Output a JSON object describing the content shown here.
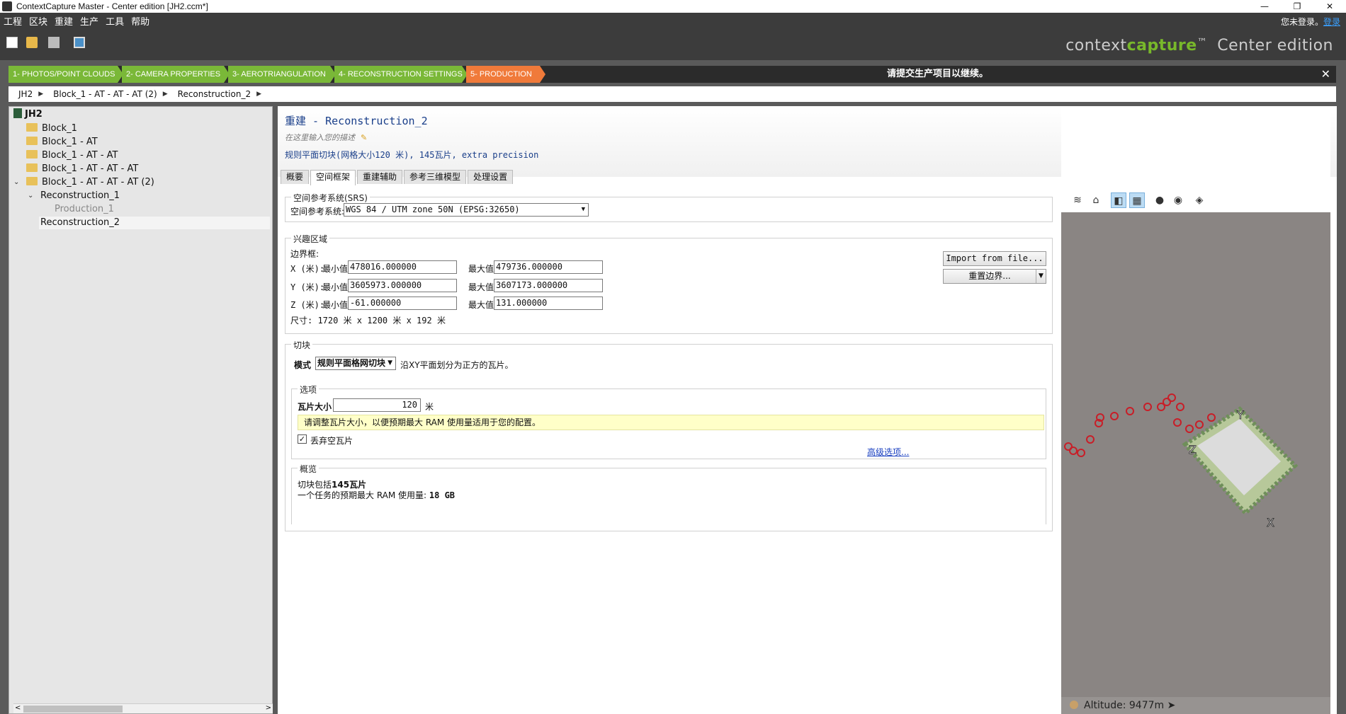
{
  "window": {
    "title": "ContextCapture Master - Center edition [JH2.ccm*]",
    "controls": [
      "—",
      "❐",
      "✕"
    ]
  },
  "menu": {
    "items": [
      "工程",
      "区块",
      "重建",
      "生产",
      "工具",
      "帮助"
    ],
    "login_text": "您未登录。",
    "login_link": "登录"
  },
  "brand": {
    "prefix": "context",
    "accent": "capture",
    "tm": "™",
    "edition": "Center edition",
    "accent_color": "#78b82a"
  },
  "steps": {
    "items": [
      "1- PHOTOS/POINT CLOUDS",
      "2- CAMERA PROPERTIES",
      "3- AEROTRIANGULATION",
      "4- RECONSTRUCTION SETTINGS",
      "5- PRODUCTION"
    ],
    "active_index": 4,
    "notice": "请提交生产项目以继续。",
    "done_color": "#7ab838",
    "active_color": "#f07a3a"
  },
  "breadcrumb": [
    "JH2",
    "Block_1 - AT - AT - AT (2)",
    "Reconstruction_2"
  ],
  "tree": {
    "root": "JH2",
    "items": [
      "Block_1",
      "Block_1 - AT",
      "Block_1 - AT - AT",
      "Block_1 - AT - AT - AT",
      "Block_1 - AT - AT - AT (2)",
      "Reconstruction_1",
      "Production_1",
      "Reconstruction_2"
    ]
  },
  "main": {
    "title_prefix": "重建",
    "title_sep": " - ",
    "title_name": "Reconstruction_2",
    "description_placeholder": "在这里输入您的描述",
    "summary": "规则平面切块(网格大小120 米), 145瓦片, extra precision",
    "tabs": [
      "概要",
      "空间框架",
      "重建辅助",
      "参考三维模型",
      "处理设置"
    ],
    "active_tab": 1
  },
  "srs": {
    "group_title": "空间参考系统(SRS)",
    "label": "空间参考系统:",
    "value": "WGS 84 / UTM zone 50N (EPSG:32650)"
  },
  "roi": {
    "group_title": "兴趣区域",
    "bbox_label": "边界框:",
    "min_label": "最小值",
    "max_label": "最大值",
    "rows": [
      {
        "axis": "X (米):",
        "min": "478016.000000",
        "max": "479736.000000"
      },
      {
        "axis": "Y (米):",
        "min": "3605973.000000",
        "max": "3607173.000000"
      },
      {
        "axis": "Z (米):",
        "min": "-61.000000",
        "max": "131.000000"
      }
    ],
    "size": "尺寸: 1720 米 x 1200 米 x 192 米",
    "import_button": "Import from file...",
    "reset_button": "重置边界..."
  },
  "tiling": {
    "group_title": "切块",
    "mode_label": "模式",
    "mode_value": "规则平面格网切块",
    "mode_desc": "沿XY平面划分为正方的瓦片。",
    "options_title": "选项",
    "tile_size_label": "瓦片大小",
    "tile_size_value": "120",
    "tile_size_unit": "米",
    "hint": "请调整瓦片大小，以便预期最大 RAM 使用量适用于您的配置。",
    "discard_label": "丢弃空瓦片",
    "discard_checked": true,
    "advanced_link": "高级选项...",
    "overview_title": "概览",
    "overview_line1_prefix": "切块包括",
    "overview_line1_value": "145瓦片",
    "overview_line2_prefix": "一个任务的预期最大 RAM 使用量: ",
    "overview_line2_value": "18 GB"
  },
  "viewer": {
    "tools": [
      "layers-icon",
      "home-icon",
      "cube-icon",
      "grid-icon",
      "small-camera-icon",
      "camera-icon",
      "box-icon"
    ],
    "axis_labels": [
      "Y",
      "Z",
      "X"
    ],
    "altitude_label": "Altitude:",
    "altitude_value": "9477m"
  }
}
